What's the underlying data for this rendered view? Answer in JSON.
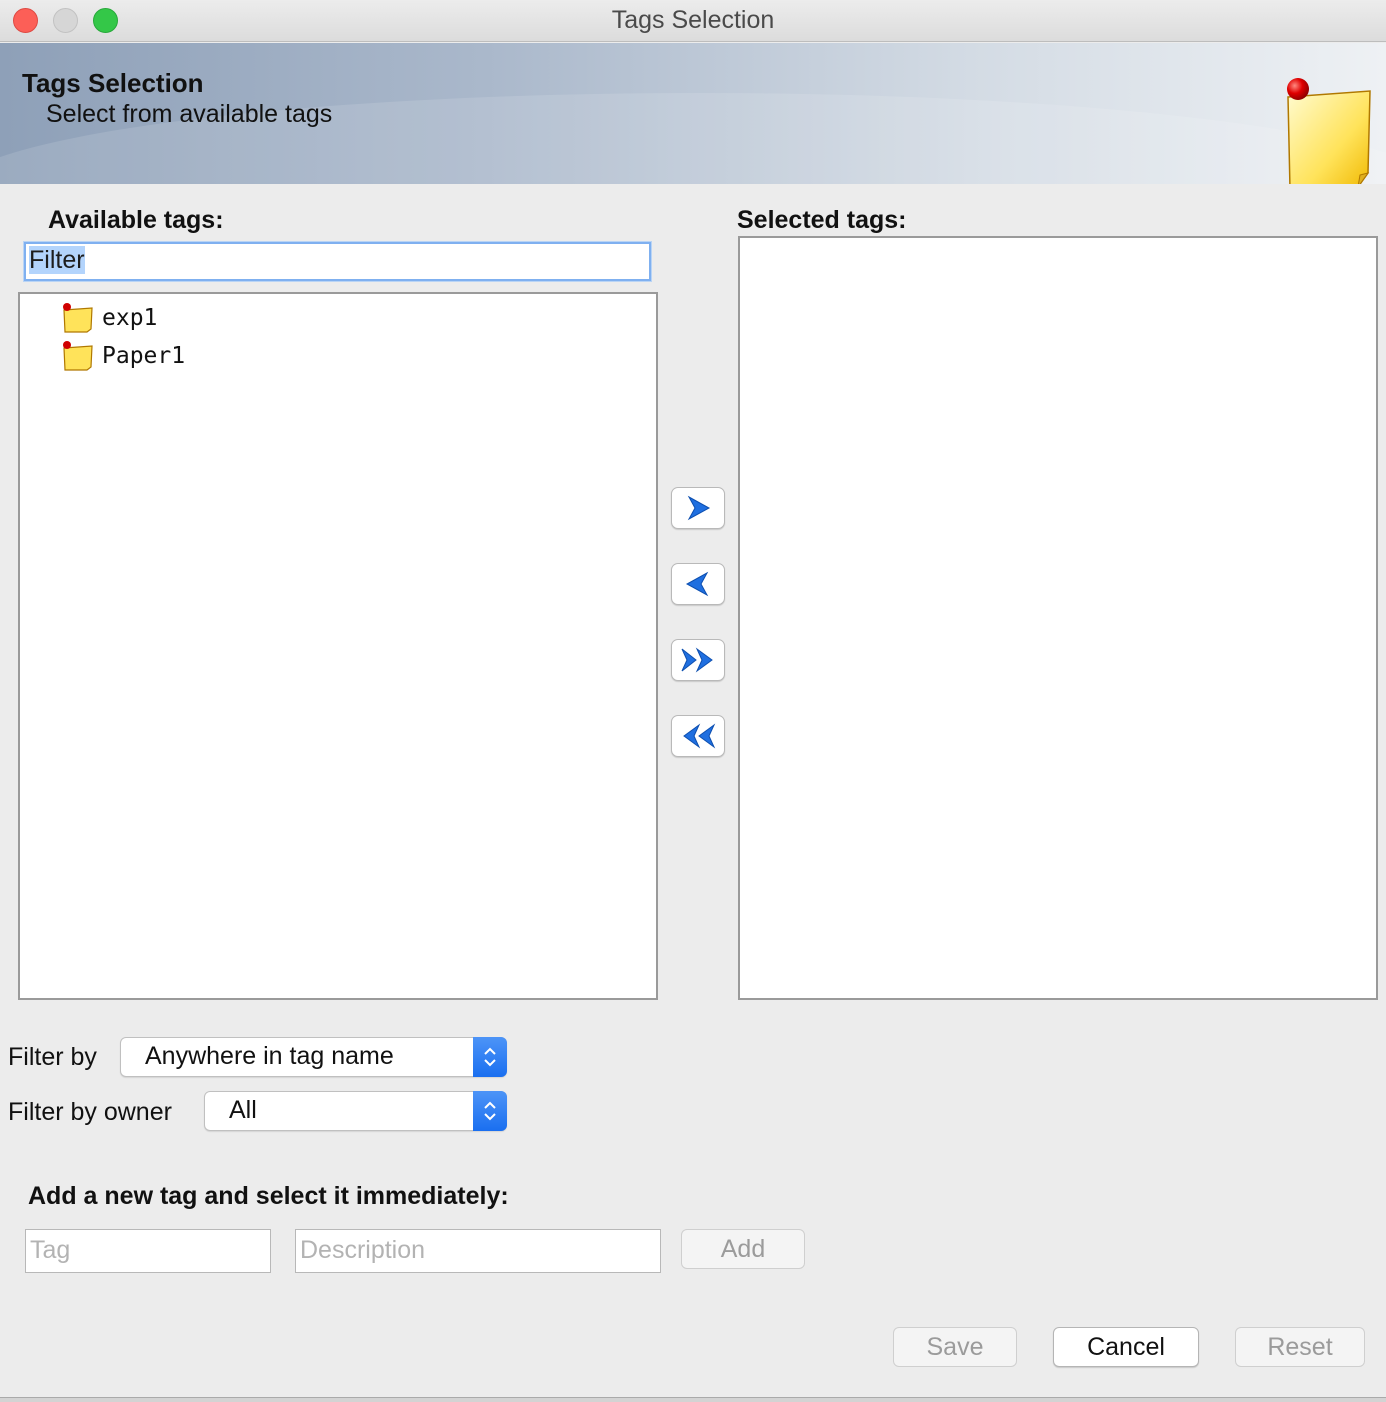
{
  "window": {
    "title": "Tags Selection"
  },
  "banner": {
    "heading": "Tags Selection",
    "subheading": "Select from available tags",
    "icon": "sticky-note-icon"
  },
  "available": {
    "label": "Available tags:",
    "filter_value": "Filter",
    "items": [
      {
        "label": "exp1",
        "icon": "tag-note-icon"
      },
      {
        "label": "Paper1",
        "icon": "tag-note-icon"
      }
    ]
  },
  "selected": {
    "label": "Selected tags:",
    "items": []
  },
  "transfer_buttons": [
    {
      "icon": "chevron-right-icon"
    },
    {
      "icon": "chevron-left-icon"
    },
    {
      "icon": "double-chevron-right-icon"
    },
    {
      "icon": "double-chevron-left-icon"
    }
  ],
  "filters": {
    "filter_by_label": "Filter by",
    "filter_by_value": "Anywhere in tag name",
    "owner_label": "Filter by owner",
    "owner_value": "All"
  },
  "new_tag": {
    "label": "Add a new tag and select it immediately:",
    "tag_placeholder": "Tag",
    "description_placeholder": "Description",
    "add_label": "Add"
  },
  "footer": {
    "save_label": "Save",
    "cancel_label": "Cancel",
    "reset_label": "Reset"
  },
  "colors": {
    "accent": "#1a6ff0",
    "arrow_blue": "#1f6fe0"
  }
}
